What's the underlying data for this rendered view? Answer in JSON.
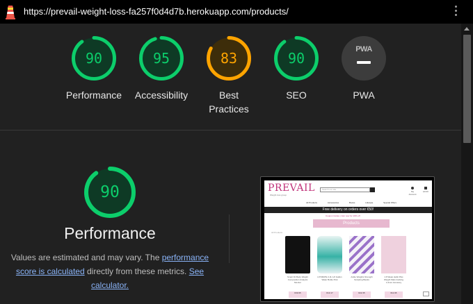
{
  "browser": {
    "url": "https://prevail-weight-loss-fa257f0d4d7b.herokuapp.com/products/"
  },
  "colors": {
    "pass": "#0cce6b",
    "average": "#ffa400",
    "na": "#757575"
  },
  "scores": [
    {
      "label": "Performance",
      "value": "90",
      "fraction": 0.9,
      "status": "pass"
    },
    {
      "label": "Accessibility",
      "value": "95",
      "fraction": 0.95,
      "status": "pass"
    },
    {
      "label": "Best Practices",
      "value": "83",
      "fraction": 0.83,
      "status": "average"
    },
    {
      "label": "SEO",
      "value": "90",
      "fraction": 0.9,
      "status": "pass"
    },
    {
      "label": "PWA",
      "value": "PWA",
      "status": "na"
    }
  ],
  "performance": {
    "score": "90",
    "fraction": 0.9,
    "title": "Performance",
    "desc_prefix": "Values are estimated and may vary. The ",
    "desc_link1": "performance score is calculated",
    "desc_middle": " directly from these metrics. ",
    "desc_link2": "See calculator."
  },
  "screenshot": {
    "logo": "PREVAIL",
    "tagline": "Weight loss group",
    "search_placeholder": "Search our site",
    "account": "My Account",
    "bag": "£0.00",
    "nav": [
      "All Products",
      "Accessories",
      "Books",
      "Lifestyle",
      "Special Offers"
    ],
    "delivery": "Free delivery on orders over €50!",
    "coupon": "Coupon Codes | Join now for 10% off",
    "banner": "Products",
    "category": "All Products",
    "products": [
      {
        "caption": "Smart Fit Body Weight Composition Analysis Monitor",
        "price": "€39.95"
      },
      {
        "caption": "HYDRATE 2.2L 1/2 Gallon Water Bottle Pink",
        "price": "€13.17"
      },
      {
        "caption": "Ankle Weights Strength Sculpting Bands",
        "price": "€22.35"
      },
      {
        "caption": "1.8 Week Habit Plus Weight Mats tracking 1,5mm Accuracy",
        "price": "€11.95"
      }
    ]
  }
}
